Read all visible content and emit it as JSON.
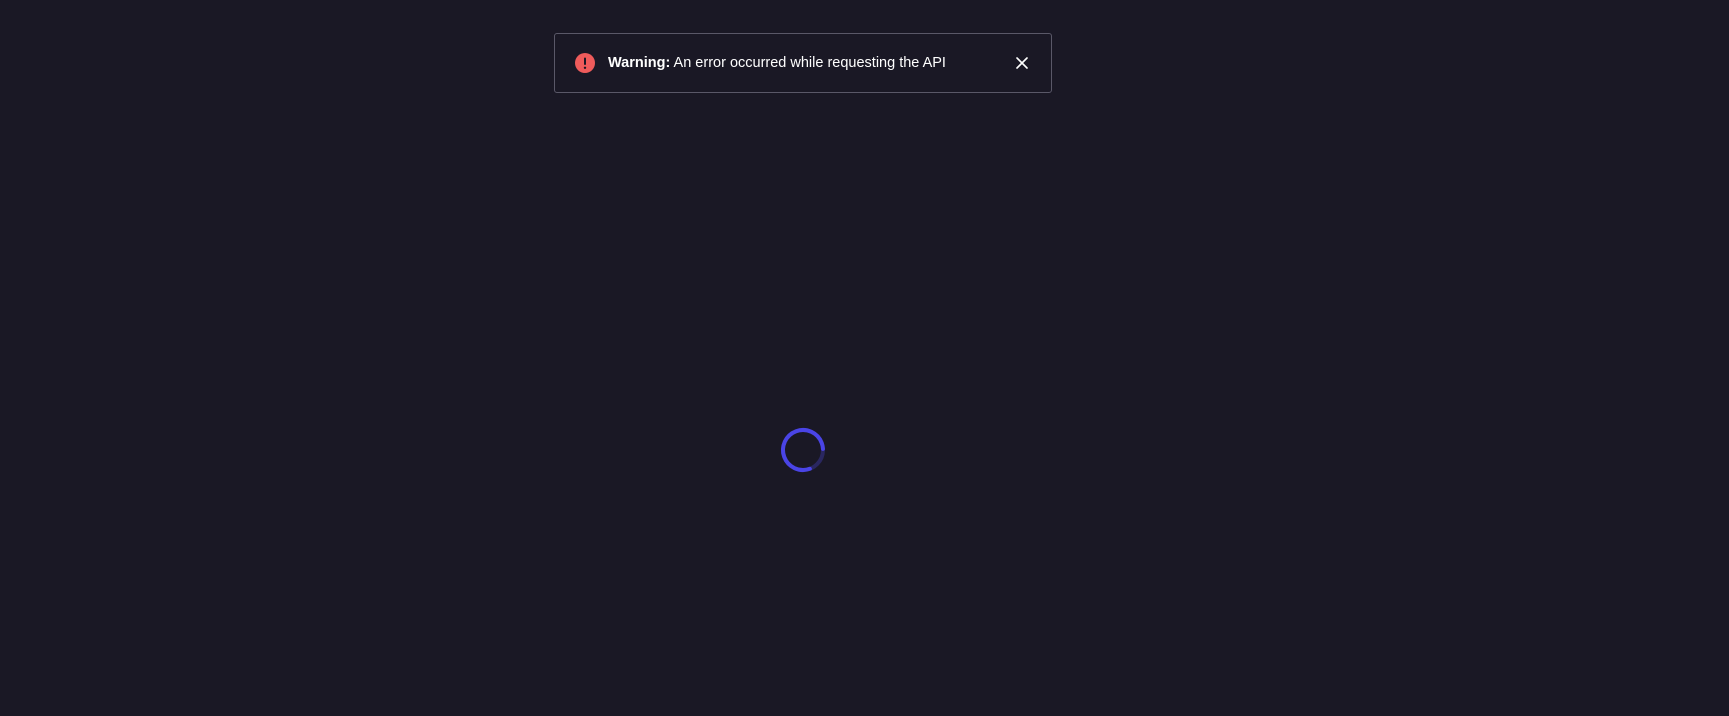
{
  "toast": {
    "title": "Warning:",
    "message": "An error occurred while requesting the API",
    "icon": "error-exclamation-icon",
    "close_icon": "close-icon",
    "icon_color": "#ef5b5b",
    "border_color": "#5a5868"
  },
  "loader": {
    "icon": "loading-spinner-icon",
    "color": "#4a44e6"
  },
  "colors": {
    "background": "#1a1825",
    "text": "#ffffff"
  }
}
